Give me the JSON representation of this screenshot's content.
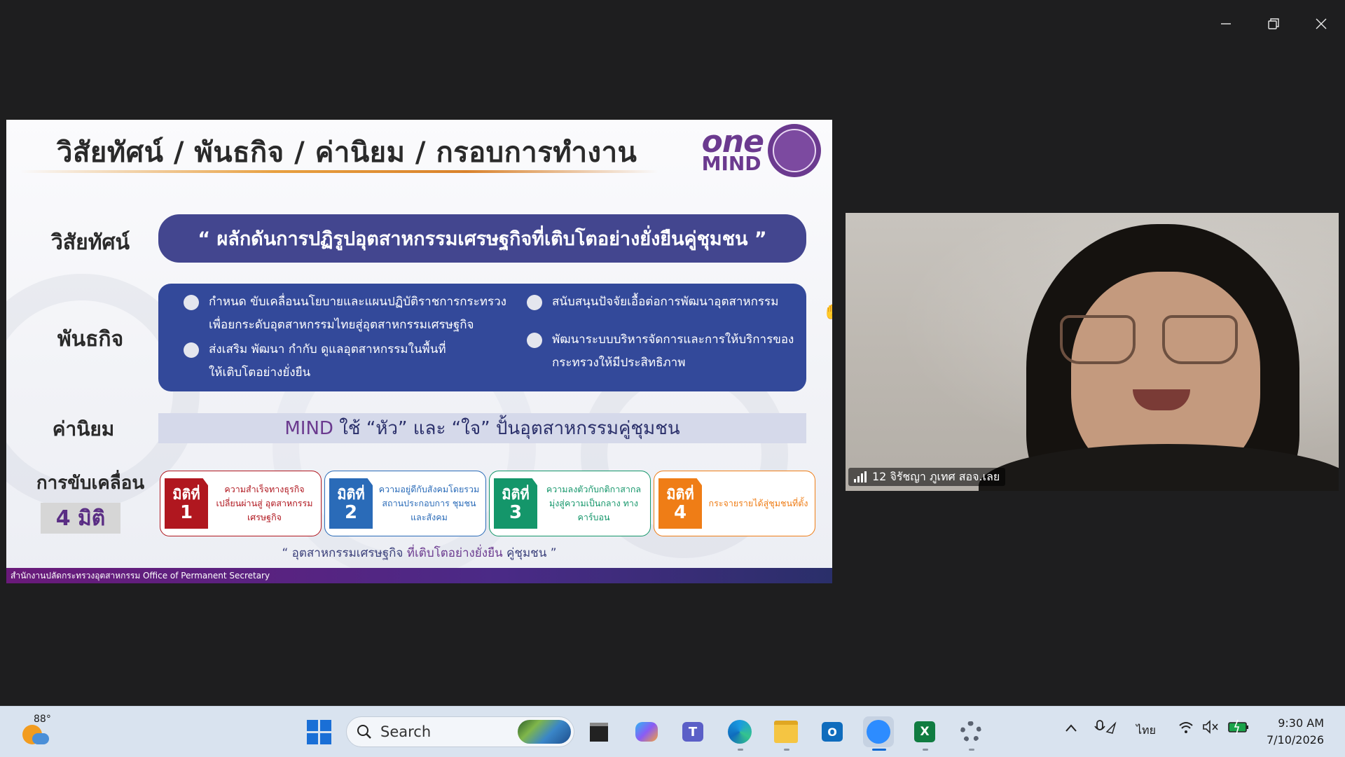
{
  "window": {
    "minimize_icon": "minimize-icon",
    "restore_icon": "restore-icon",
    "close_icon": "close-icon"
  },
  "slide": {
    "title": "วิสัยทัศน์ / พันธกิจ / ค่านิยม / กรอบการทำงาน",
    "logo": {
      "one": "one",
      "mind": "MIND"
    },
    "labels": {
      "vision": "วิสัยทัศน์",
      "mission": "พันธกิจ",
      "values": "ค่านิยม",
      "drive": "การขับเคลื่อน",
      "drive_count": "4 มิติ"
    },
    "vision_text": "“ ผลักดันการปฏิรูปอุตสาหกรรมเศรษฐกิจที่เติบโตอย่างยั่งยืนคู่ชุมชน ”",
    "mission": [
      {
        "line1": "กำหนด ขับเคลื่อนนโยบายและแผนปฏิบัติราชการกระทรวง",
        "line2": "เพื่อยกระดับอุตสาหกรรมไทยสู่อุตสาหกรรมเศรษฐกิจ"
      },
      {
        "line1": "ส่งเสริม พัฒนา กำกับ ดูแลอุตสาหกรรมในพื้นที่",
        "line2": "ให้เติบโตอย่างยั่งยืน"
      },
      {
        "line1": "สนับสนุนปัจจัยเอื้อต่อการพัฒนาอุตสาหกรรม",
        "line2": ""
      },
      {
        "line1": "พัฒนาระบบบริหารจัดการและการให้บริการของ",
        "line2": "กระทรวงให้มีประสิทธิภาพ"
      }
    ],
    "values": {
      "mind": "MIND",
      "rest": " ใช้ “หัว” และ “ใจ” ปั้นอุตสาหกรรมคู่ชุมชน"
    },
    "dimensions": [
      {
        "label": "มิติที่",
        "num": "1",
        "color": "#b0171f",
        "text": "ความสำเร็จทางธุรกิจ เปลี่ยนผ่านสู่ อุตสาหกรรมเศรษฐกิจ"
      },
      {
        "label": "มิติที่",
        "num": "2",
        "color": "#2a6bb8",
        "text": "ความอยู่ดีกับสังคมโดยรวม สถานประกอบการ ชุมชน และสังคม"
      },
      {
        "label": "มิติที่",
        "num": "3",
        "color": "#14966a",
        "text": "ความลงตัวกับกติกาสากล มุ่งสู่ความเป็นกลาง ทางคาร์บอน"
      },
      {
        "label": "มิติที่",
        "num": "4",
        "color": "#ef7d16",
        "text": "กระจายรายได้สู่ชุมชนที่ตั้ง"
      }
    ],
    "slogan": {
      "a": "“ อุตสาหกรรมเศรษฐกิจ ",
      "b": "ที่เติบโตอย่างยั่งยืน",
      "c": " คู่ชุมชน ”"
    },
    "footer": "สำนักงานปลัดกระทรวงอุตสาหกรรม Office of Permanent Secretary"
  },
  "participant": {
    "name": "12 จิรัชญา ภูเทศ สอจ.เลย",
    "signal_icon": "signal-bars-icon"
  },
  "taskbar": {
    "weather_temp": "88°",
    "search_label": "Search",
    "apps": [
      "start-icon",
      "file-viewer-icon",
      "copilot-icon",
      "teams-icon",
      "edge-icon",
      "file-explorer-icon",
      "outlook-icon",
      "zoom-icon",
      "excel-icon",
      "settings-icon"
    ],
    "lang": "ไทย",
    "time": "9:30 AM",
    "date": "7/10/2026"
  }
}
